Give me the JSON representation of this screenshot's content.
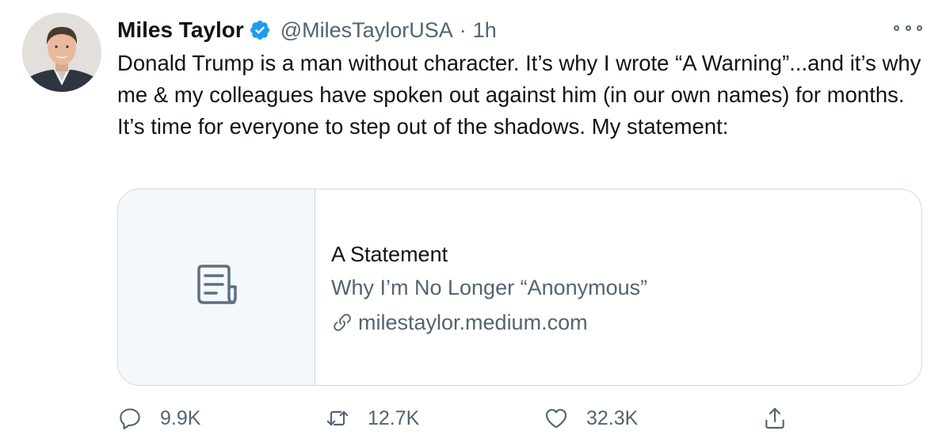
{
  "author": {
    "display_name": "Miles Taylor",
    "handle": "@MilesTaylorUSA",
    "separator": "·",
    "time": "1h"
  },
  "tweet": {
    "text": "Donald Trump is a man without character. It’s why I wrote “A Warning”...and it’s why me & my colleagues have spoken out against him (in our own names) for months. It’s time for everyone to step out of the shadows. My statement:"
  },
  "card": {
    "title": "A Statement",
    "description": "Why I’m No Longer “Anonymous”",
    "domain": "milestaylor.medium.com"
  },
  "actions": {
    "replies": "9.9K",
    "retweets": "12.7K",
    "likes": "32.3K"
  },
  "icons": {
    "verified": "verified-badge-icon",
    "more": "more-options-icon",
    "card_thumb": "document-icon",
    "link": "link-icon",
    "reply": "reply-icon",
    "retweet": "retweet-icon",
    "like": "heart-icon",
    "share": "share-icon"
  },
  "colors": {
    "accent": "#1d9bf0",
    "secondary_text": "#536471",
    "primary_text": "#0f1419",
    "border": "#cfd9de"
  }
}
